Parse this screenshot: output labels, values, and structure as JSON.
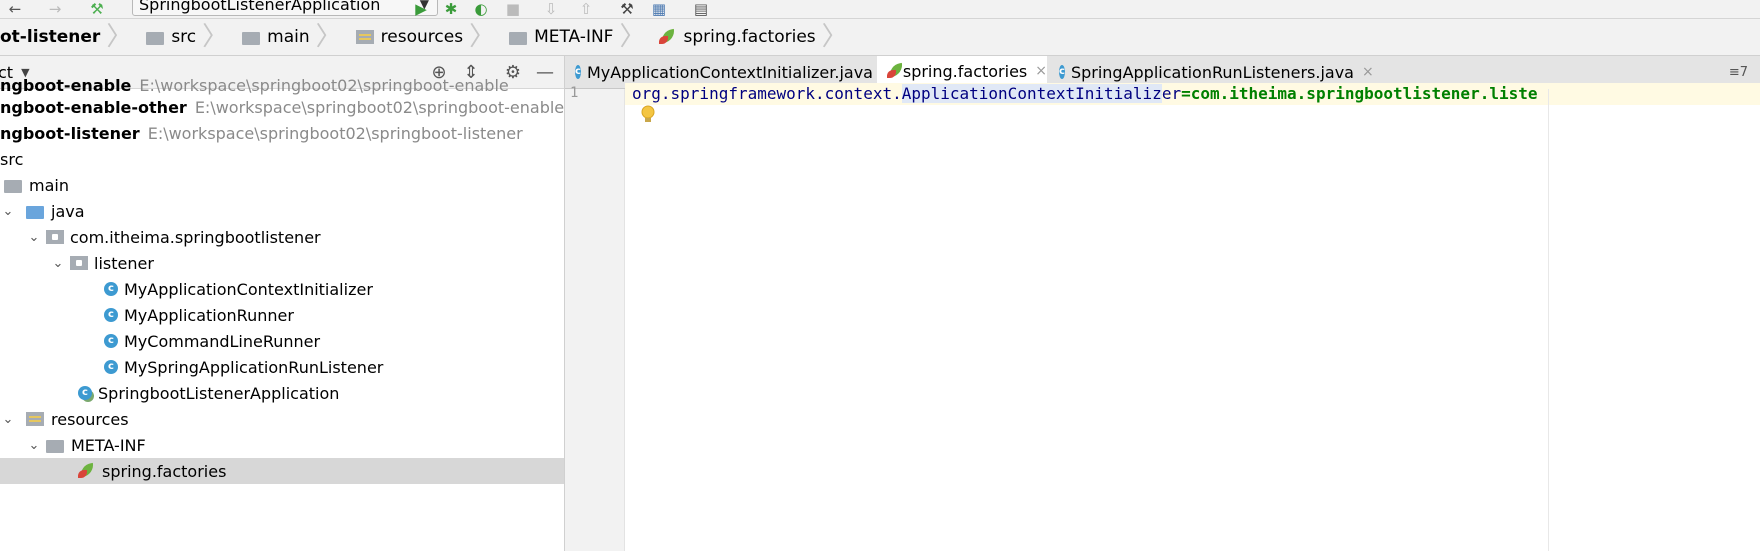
{
  "run_config": {
    "label": "SpringbootListenerApplication"
  },
  "breadcrumb": [
    {
      "label": "ot-listener",
      "icon": "none",
      "bold": true
    },
    {
      "label": "src",
      "icon": "folder-icon"
    },
    {
      "label": "main",
      "icon": "folder-icon"
    },
    {
      "label": "resources",
      "icon": "resources-folder-icon"
    },
    {
      "label": "META-INF",
      "icon": "folder-icon"
    },
    {
      "label": "spring.factories",
      "icon": "spring-leaf-icon"
    }
  ],
  "project_panel": {
    "title": "ct",
    "tree": [
      {
        "label": "ngboot-enable",
        "path": "E:\\workspace\\springboot02\\springboot-enable",
        "bold": true
      },
      {
        "label": "ngboot-enable-other",
        "path": "E:\\workspace\\springboot02\\springboot-enable-other",
        "bold": true
      },
      {
        "label": "ngboot-listener",
        "path": "E:\\workspace\\springboot02\\springboot-listener",
        "bold": true
      },
      {
        "label": "src"
      },
      {
        "label": "main"
      },
      {
        "label": "java"
      },
      {
        "label": "com.itheima.springbootlistener"
      },
      {
        "label": "listener"
      },
      {
        "label": "MyApplicationContextInitializer"
      },
      {
        "label": "MyApplicationRunner"
      },
      {
        "label": "MyCommandLineRunner"
      },
      {
        "label": "MySpringApplicationRunListener"
      },
      {
        "label": "SpringbootListenerApplication"
      },
      {
        "label": "resources"
      },
      {
        "label": "META-INF"
      },
      {
        "label": "spring.factories"
      }
    ]
  },
  "editor": {
    "tabs": [
      {
        "label": "MyApplicationContextInitializer.java",
        "close": "×"
      },
      {
        "label": "spring.factories",
        "close": "×",
        "active": true
      },
      {
        "label": "SpringApplicationRunListeners.java",
        "close": "×"
      }
    ],
    "tab_menu": "≡7",
    "line_number": "1",
    "code": {
      "key_prefix": "org.springframework.context.",
      "key_selected": "ApplicationContextInitializ",
      "key_suffix": "er",
      "value": "=com.itheima.springbootlistener.liste"
    }
  }
}
